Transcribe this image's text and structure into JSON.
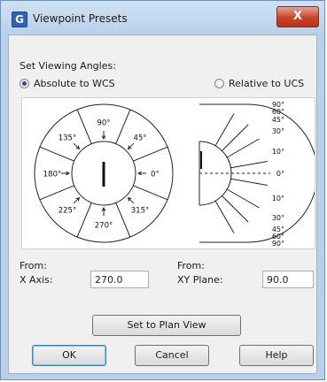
{
  "window": {
    "title": "Viewpoint Presets",
    "icon": "G",
    "close_label": "X"
  },
  "angles": {
    "heading": "Set Viewing Angles:",
    "options": [
      {
        "label": "Absolute to WCS",
        "checked": true
      },
      {
        "label": "Relative to UCS",
        "checked": false
      }
    ]
  },
  "wheel_labels": [
    "90°",
    "45°",
    "0°",
    "315°",
    "270°",
    "225°",
    "180°",
    "135°"
  ],
  "elevation_labels_top": [
    "90°",
    "60°",
    "45°",
    "30°",
    "10°"
  ],
  "elevation_center_label": "0°",
  "elevation_labels_bottom": [
    "10°",
    "30°",
    "45°",
    "60°",
    "90°"
  ],
  "from": {
    "x_axis": {
      "heading": "From:",
      "label": "X Axis:",
      "value": "270.0"
    },
    "xy_plane": {
      "heading": "From:",
      "label": "XY Plane:",
      "value": "90.0"
    }
  },
  "buttons": {
    "plan_view": "Set to Plan View",
    "ok": "OK",
    "cancel": "Cancel",
    "help": "Help"
  }
}
